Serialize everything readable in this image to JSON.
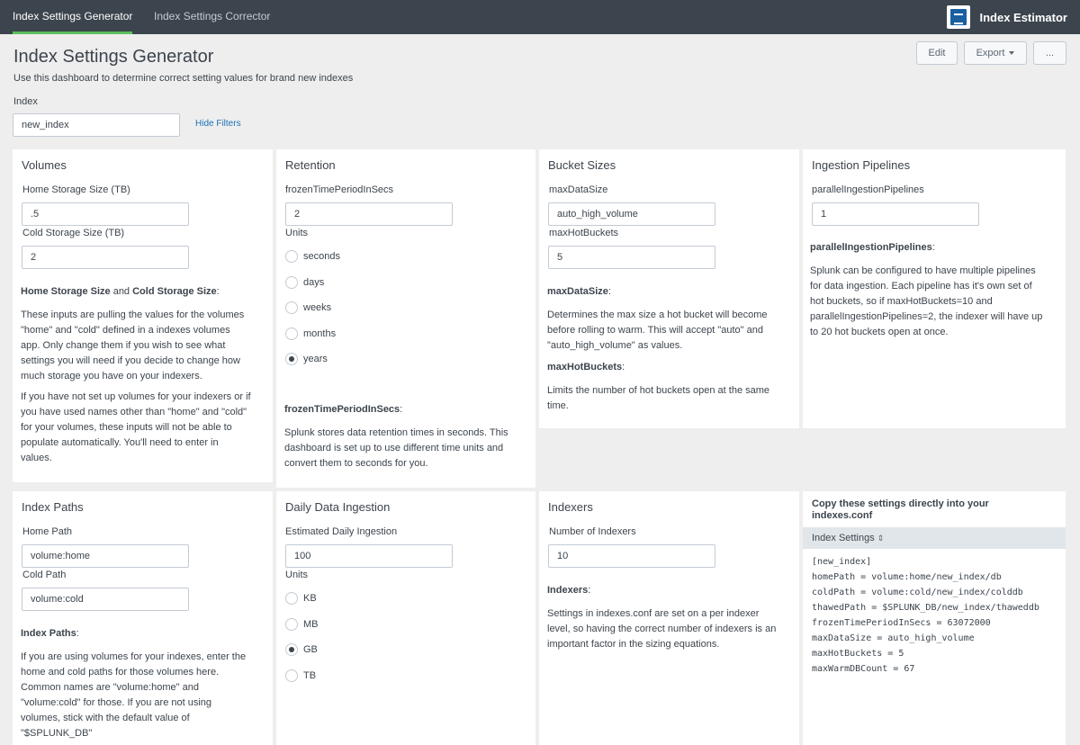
{
  "nav": {
    "tabs": [
      {
        "label": "Index Settings Generator"
      },
      {
        "label": "Index Settings Corrector"
      }
    ],
    "app_title": "Index Estimator"
  },
  "header": {
    "title": "Index Settings Generator",
    "description": "Use this dashboard to determine correct setting values for brand new indexes",
    "edit_label": "Edit",
    "export_label": "Export",
    "more_label": "..."
  },
  "filters": {
    "index_label": "Index",
    "index_value": "new_index",
    "hide_filters": "Hide Filters"
  },
  "volumes": {
    "title": "Volumes",
    "home_label": "Home Storage Size (TB)",
    "home_value": ".5",
    "cold_label": "Cold Storage Size (TB)",
    "cold_value": "2",
    "help_bold1": "Home Storage Size",
    "help_and": " and ",
    "help_bold2": "Cold Storage Size",
    "help_colon": ":",
    "help_lines1": [
      "These inputs are pulling the values for the volumes",
      "\"home\" and \"cold\" defined in a indexes volumes",
      "app. Only change them if you wish to see what",
      "settings you will need if you decide to change how",
      "much storage you have on your indexers."
    ],
    "help_lines2": [
      "If you have not set up volumes for your indexers or if",
      "you have used names other than \"home\" and \"cold\"",
      "for your volumes, these inputs will not be able to",
      "populate automatically. You'll need to enter in",
      "values."
    ]
  },
  "retention": {
    "title": "Retention",
    "frozen_label": "frozenTimePeriodInSecs",
    "frozen_value": "2",
    "units_label": "Units",
    "units": [
      {
        "label": "seconds",
        "selected": false
      },
      {
        "label": "days",
        "selected": false
      },
      {
        "label": "weeks",
        "selected": false
      },
      {
        "label": "months",
        "selected": false
      },
      {
        "label": "years",
        "selected": true
      }
    ],
    "help_bold": "frozenTimePeriodInSecs",
    "help_colon": ":",
    "help_lines": [
      "Splunk stores data retention times in seconds. This",
      "dashboard is set up to use different time units and",
      "convert them to seconds for you."
    ]
  },
  "buckets": {
    "title": "Bucket Sizes",
    "maxdata_label": "maxDataSize",
    "maxdata_value": "auto_high_volume",
    "maxhot_label": "maxHotBuckets",
    "maxhot_value": "5",
    "help1_bold": "maxDataSize",
    "help1_colon": ":",
    "help1_lines": [
      "Determines the max size a hot bucket will become",
      "before rolling to warm. This will accept \"auto\" and",
      "\"auto_high_volume\" as values."
    ],
    "help2_bold": "maxHotBuckets",
    "help2_colon": ":",
    "help2_lines": [
      "Limits the number of hot buckets open at the same",
      "time."
    ]
  },
  "pipelines": {
    "title": "Ingestion Pipelines",
    "label": "parallelIngestionPipelines",
    "value": "1",
    "help_bold": "parallelIngestionPipelines",
    "help_colon": ":",
    "help_lines": [
      "Splunk can be configured to have multiple pipelines",
      "for data ingestion. Each pipeline has it's own set of",
      "hot buckets, so if maxHotBuckets=10 and",
      "parallelIngestionPipelines=2, the indexer will have up",
      "to 20 hot buckets open at once."
    ]
  },
  "paths": {
    "title": "Index Paths",
    "home_label": "Home Path",
    "home_value": "volume:home",
    "cold_label": "Cold Path",
    "cold_value": "volume:cold",
    "help_bold": "Index Paths",
    "help_colon": ":",
    "help_lines": [
      "If you are using volumes for your indexes, enter the",
      "home and cold paths for those volumes here.",
      "Common names are \"volume:home\" and",
      "\"volume:cold\" for those. If you are not using",
      "volumes, stick with the default value of",
      "\"$SPLUNK_DB\""
    ]
  },
  "ingestion": {
    "title": "Daily Data Ingestion",
    "est_label": "Estimated Daily Ingestion",
    "est_value": "100",
    "units_label": "Units",
    "units": [
      {
        "label": "KB",
        "selected": false
      },
      {
        "label": "MB",
        "selected": false
      },
      {
        "label": "GB",
        "selected": true
      },
      {
        "label": "TB",
        "selected": false
      }
    ]
  },
  "indexers": {
    "title": "Indexers",
    "num_label": "Number of Indexers",
    "num_value": "10",
    "help_bold": "Indexers",
    "help_colon": ":",
    "help_lines": [
      "Settings in indexes.conf are set on a per indexer",
      "level, so having the correct number of indexers is an",
      "important factor in the sizing equations."
    ]
  },
  "copy": {
    "title": "Copy these settings directly into your indexes.conf",
    "table_header": "Index Settings",
    "sort_icon": "sort-icon",
    "lines": [
      "[new_index]",
      "homePath = volume:home/new_index/db",
      "coldPath = volume:cold/new_index/colddb",
      "thawedPath = $SPLUNK_DB/new_index/thaweddb",
      "frozenTimePeriodInSecs = 63072000",
      "maxDataSize = auto_high_volume",
      "maxHotBuckets = 5",
      "maxWarmDBCount = 67"
    ]
  }
}
